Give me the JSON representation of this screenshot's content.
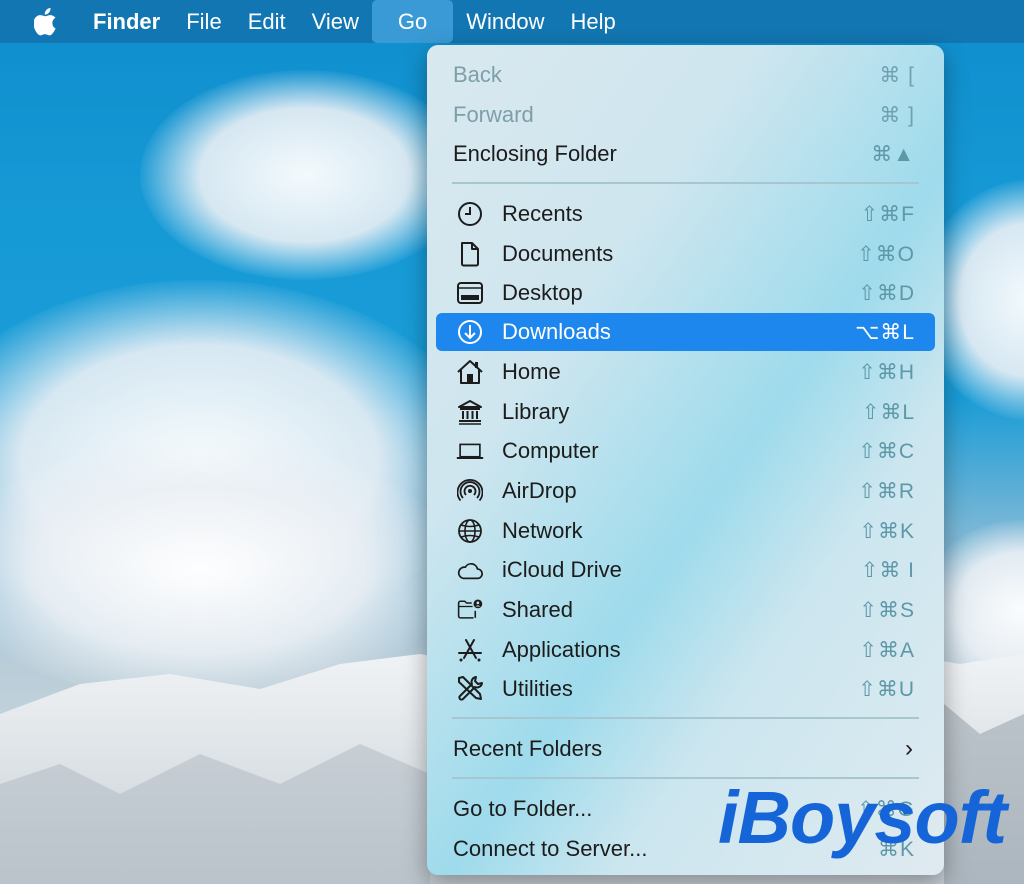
{
  "menubar": {
    "apple_icon": "apple-logo-icon",
    "items": [
      {
        "label": "Finder"
      },
      {
        "label": "File"
      },
      {
        "label": "Edit"
      },
      {
        "label": "View"
      },
      {
        "label": "Go"
      },
      {
        "label": "Window"
      },
      {
        "label": "Help"
      }
    ],
    "active": "Go"
  },
  "go_menu": {
    "items": [
      {
        "label": "Back",
        "shortcut": "⌘ [",
        "disabled": true
      },
      {
        "label": "Forward",
        "shortcut": "⌘ ]",
        "disabled": true
      },
      {
        "label": "Enclosing Folder",
        "shortcut": "⌘▲"
      },
      {
        "label": "Recents",
        "shortcut": "⇧⌘F",
        "icon": "clock-icon"
      },
      {
        "label": "Documents",
        "shortcut": "⇧⌘O",
        "icon": "document-icon"
      },
      {
        "label": "Desktop",
        "shortcut": "⇧⌘D",
        "icon": "desktop-icon"
      },
      {
        "label": "Downloads",
        "shortcut": "⌥⌘L",
        "icon": "download-icon",
        "selected": true
      },
      {
        "label": "Home",
        "shortcut": "⇧⌘H",
        "icon": "home-icon"
      },
      {
        "label": "Library",
        "shortcut": "⇧⌘L",
        "icon": "library-icon"
      },
      {
        "label": "Computer",
        "shortcut": "⇧⌘C",
        "icon": "laptop-icon"
      },
      {
        "label": "AirDrop",
        "shortcut": "⇧⌘R",
        "icon": "airdrop-icon"
      },
      {
        "label": "Network",
        "shortcut": "⇧⌘K",
        "icon": "globe-icon"
      },
      {
        "label": "iCloud Drive",
        "shortcut": "⇧⌘ I",
        "icon": "cloud-icon"
      },
      {
        "label": "Shared",
        "shortcut": "⇧⌘S",
        "icon": "shared-folder-icon"
      },
      {
        "label": "Applications",
        "shortcut": "⇧⌘A",
        "icon": "applications-icon"
      },
      {
        "label": "Utilities",
        "shortcut": "⇧⌘U",
        "icon": "utilities-icon"
      },
      {
        "label": "Recent Folders",
        "submenu": true
      },
      {
        "label": "Go to Folder...",
        "shortcut": "⇧⌘G"
      },
      {
        "label": "Connect to Server...",
        "shortcut": "⌘K"
      }
    ]
  },
  "watermark": {
    "text": "iBoysoft"
  },
  "colors": {
    "menubar": "#1276b2",
    "selection": "#1d87ee",
    "watermark": "#1565d8"
  }
}
